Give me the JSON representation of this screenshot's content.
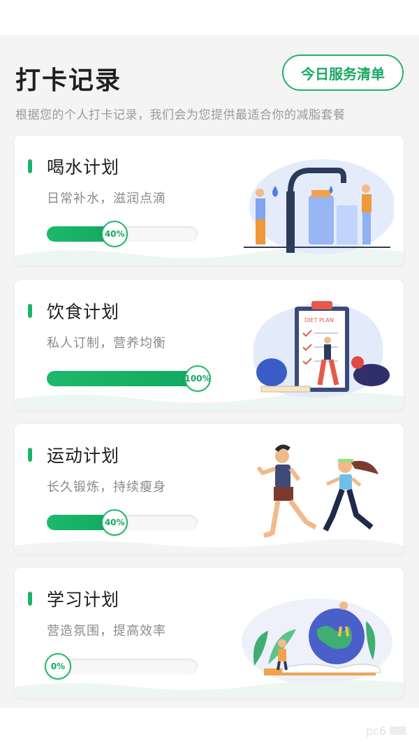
{
  "header": {
    "title": "打卡记录",
    "service_button": "今日服务清单",
    "subtitle": "根据您的个人打卡记录，我们会为您提供最适合你的减脂套餐"
  },
  "plans": [
    {
      "title": "喝水计划",
      "desc": "日常补水，滋润点滴",
      "progress_label": "40%",
      "progress": 0.4,
      "illustration": "water-dispenser-illustration"
    },
    {
      "title": "饮食计划",
      "desc": "私人订制，营养均衡",
      "progress_label": "100%",
      "progress": 1.0,
      "illustration": "diet-plan-illustration",
      "board_text": "DIET PLAN"
    },
    {
      "title": "运动计划",
      "desc": "长久锻炼，持续瘦身",
      "progress_label": "40%",
      "progress": 0.4,
      "illustration": "runners-illustration"
    },
    {
      "title": "学习计划",
      "desc": "营造氛围，提高效率",
      "progress_label": "0%",
      "progress": 0.0,
      "illustration": "study-globe-illustration"
    }
  ],
  "colors": {
    "accent": "#18b46a",
    "page_bg": "#f4f4f4"
  }
}
